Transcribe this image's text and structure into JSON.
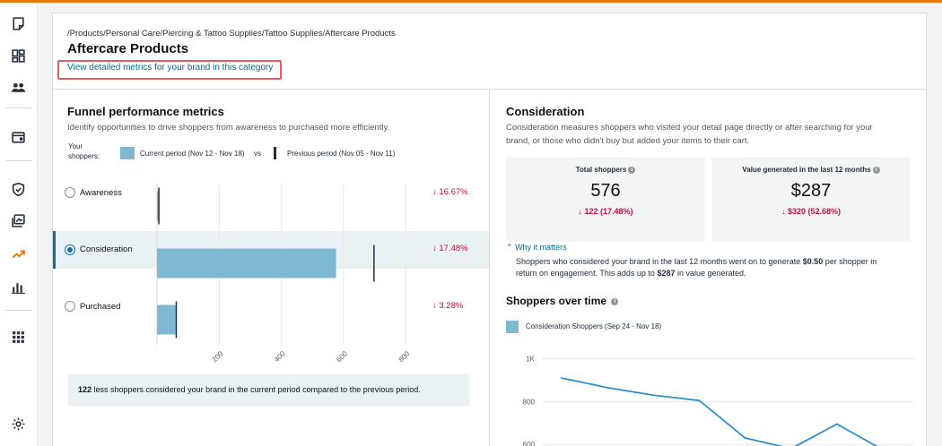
{
  "breadcrumb": "/Products/Personal Care/Piercing & Tattoo Supplies/Tattoo Supplies/Aftercare Products",
  "page_title": "Aftercare Products",
  "brand_link": "View detailed metrics for your brand in this category",
  "sidebar": {
    "icons": [
      "notes-icon",
      "dashboard-icon",
      "people-icon",
      "wallet-icon",
      "shield-icon",
      "media-icon",
      "trending-icon",
      "bar-chart-icon",
      "apps-grid-icon",
      "settings-icon"
    ]
  },
  "funnel": {
    "title": "Funnel performance metrics",
    "description": "Identify opportunities to drive shoppers from awareness to purchased more efficiently.",
    "legend_label": "Your shoppers:",
    "legend_current": "Current period (Nov 12 - Nov 18)",
    "legend_vs": "vs",
    "legend_previous": "Previous period (Nov 05 - Nov 11)",
    "rows": [
      {
        "label": "Awareness",
        "change": "↓ 16.67%",
        "selected": false
      },
      {
        "label": "Consideration",
        "change": "↓ 17.48%",
        "selected": true
      },
      {
        "label": "Purchased",
        "change": "↓ 3.28%",
        "selected": false
      }
    ],
    "summary_bold": "122",
    "summary_rest": " less shoppers considered your brand in the current period compared to the previous period."
  },
  "chart_data": [
    {
      "type": "bar",
      "orientation": "horizontal",
      "categories": [
        "Awareness",
        "Consideration",
        "Purchased"
      ],
      "series": [
        {
          "name": "Current period (Nov 12 - Nov 18)",
          "values": [
            5,
            576,
            60
          ]
        },
        {
          "name": "Previous period (Nov 05 - Nov 11)",
          "values": [
            6,
            698,
            62
          ]
        }
      ],
      "x_ticks": [
        "200",
        "400",
        "600",
        "800"
      ],
      "xlim": [
        0,
        860
      ],
      "colors": {
        "current": "#7fb8d3",
        "previous": "#232f3e"
      }
    },
    {
      "type": "line",
      "title": "Shoppers over time",
      "series": [
        {
          "name": "Consideration Shoppers (Sep 24 - Nov 18)",
          "values": [
            910,
            865,
            830,
            805,
            630,
            580,
            695,
            575
          ]
        }
      ],
      "y_ticks": [
        "1K",
        "800",
        "600"
      ],
      "ylim": [
        580,
        1040
      ],
      "color": "#2f8fc7"
    }
  ],
  "consideration": {
    "title": "Consideration",
    "description_line1": "Consideration measures shoppers who visited your detail page directly or after searching for your",
    "description_line2": "brand, or those who didn't buy but added your items to their cart.",
    "total_shoppers_label": "Total shoppers",
    "total_shoppers_value": "576",
    "total_shoppers_change": "↓ 122 (17.48%)",
    "value_label": "Value generated in the last 12 months",
    "value_value": "$287",
    "value_change": "↓ $320 (52.68%)",
    "why_link": "Why it matters",
    "why_text_1": "Shoppers who considered your brand in the last 12 months went on to generate ",
    "why_bold_1": "$0.50",
    "why_text_2": " per shopper in return on engagement. This adds up to ",
    "why_bold_2": "$287",
    "why_text_3": " in value generated.",
    "sot_title": "Shoppers over time",
    "sot_legend": "Consideration Shoppers (Sep 24 - Nov 18)"
  }
}
